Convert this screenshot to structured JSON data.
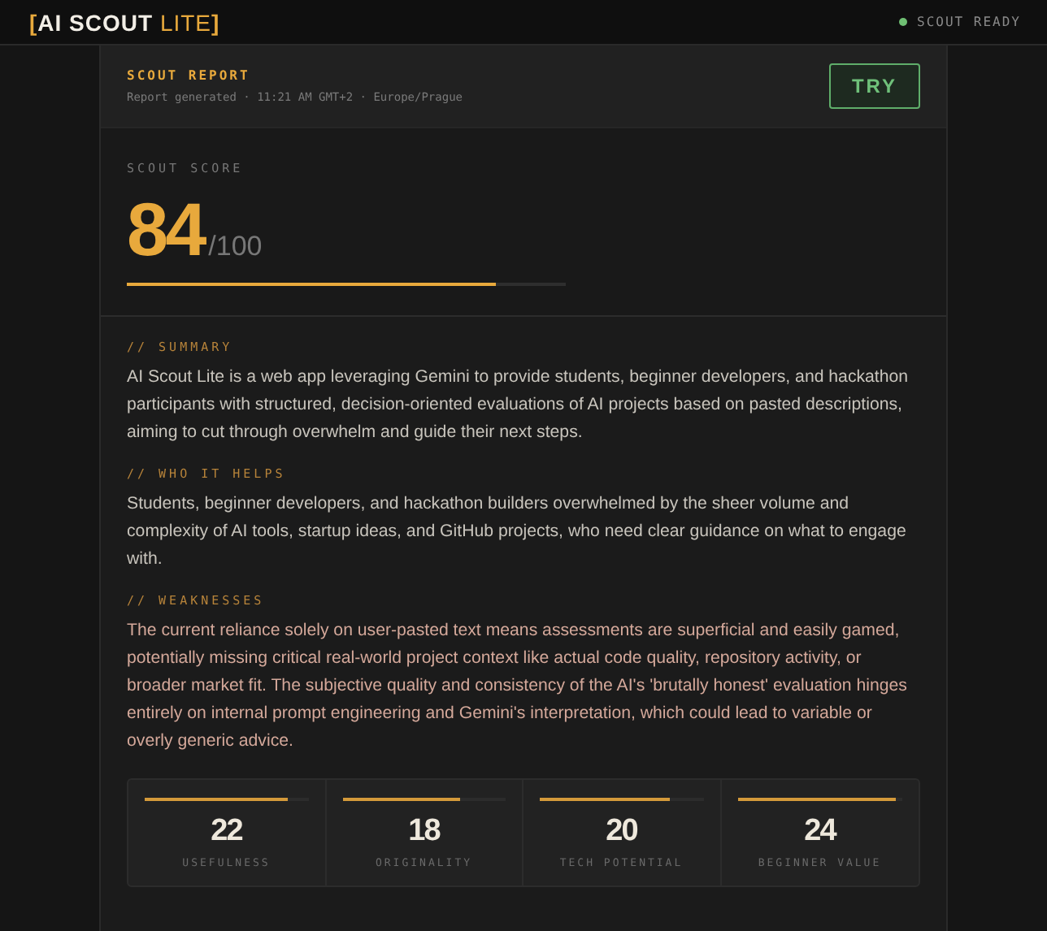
{
  "header": {
    "logo_open": "[",
    "logo_main": "AI SCOUT",
    "logo_accent": "LITE",
    "logo_close": "]",
    "status": "SCOUT READY"
  },
  "report": {
    "title": "SCOUT REPORT",
    "meta": "Report generated · 11:21 AM GMT+2 · Europe/Prague",
    "button": "TRY"
  },
  "score": {
    "label": "SCOUT SCORE",
    "value": "84",
    "max": "/100",
    "level": 0.84
  },
  "sections": [
    {
      "heading": "// SUMMARY",
      "body": "AI Scout Lite is a web app leveraging Gemini to provide students, beginner developers, and hackathon participants with structured, decision-oriented evaluations of AI projects based on pasted descriptions, aiming to cut through overwhelm and guide their next steps.",
      "kind": "plain"
    },
    {
      "heading": "// WHO IT HELPS",
      "body": "Students, beginner developers, and hackathon builders overwhelmed by the sheer volume and complexity of AI tools, startup ideas, and GitHub projects, who need clear guidance on what to engage with.",
      "kind": "plain"
    },
    {
      "heading": "// WEAKNESSES",
      "body": "The current reliance solely on user-pasted text means assessments are superficial and easily gamed, potentially missing critical real-world project context like actual code quality, repository activity, or broader market fit. The subjective quality and consistency of the AI's 'brutally honest' evaluation hinges entirely on internal prompt engineering and Gemini's interpretation, which could lead to variable or overly generic advice.",
      "kind": "warning"
    }
  ],
  "metrics": [
    {
      "value": "22",
      "label": "USEFULNESS",
      "level": 0.88
    },
    {
      "value": "18",
      "label": "ORIGINALITY",
      "level": 0.72
    },
    {
      "value": "20",
      "label": "TECH POTENTIAL",
      "level": 0.8
    },
    {
      "value": "24",
      "label": "BEGINNER VALUE",
      "level": 0.96
    }
  ]
}
